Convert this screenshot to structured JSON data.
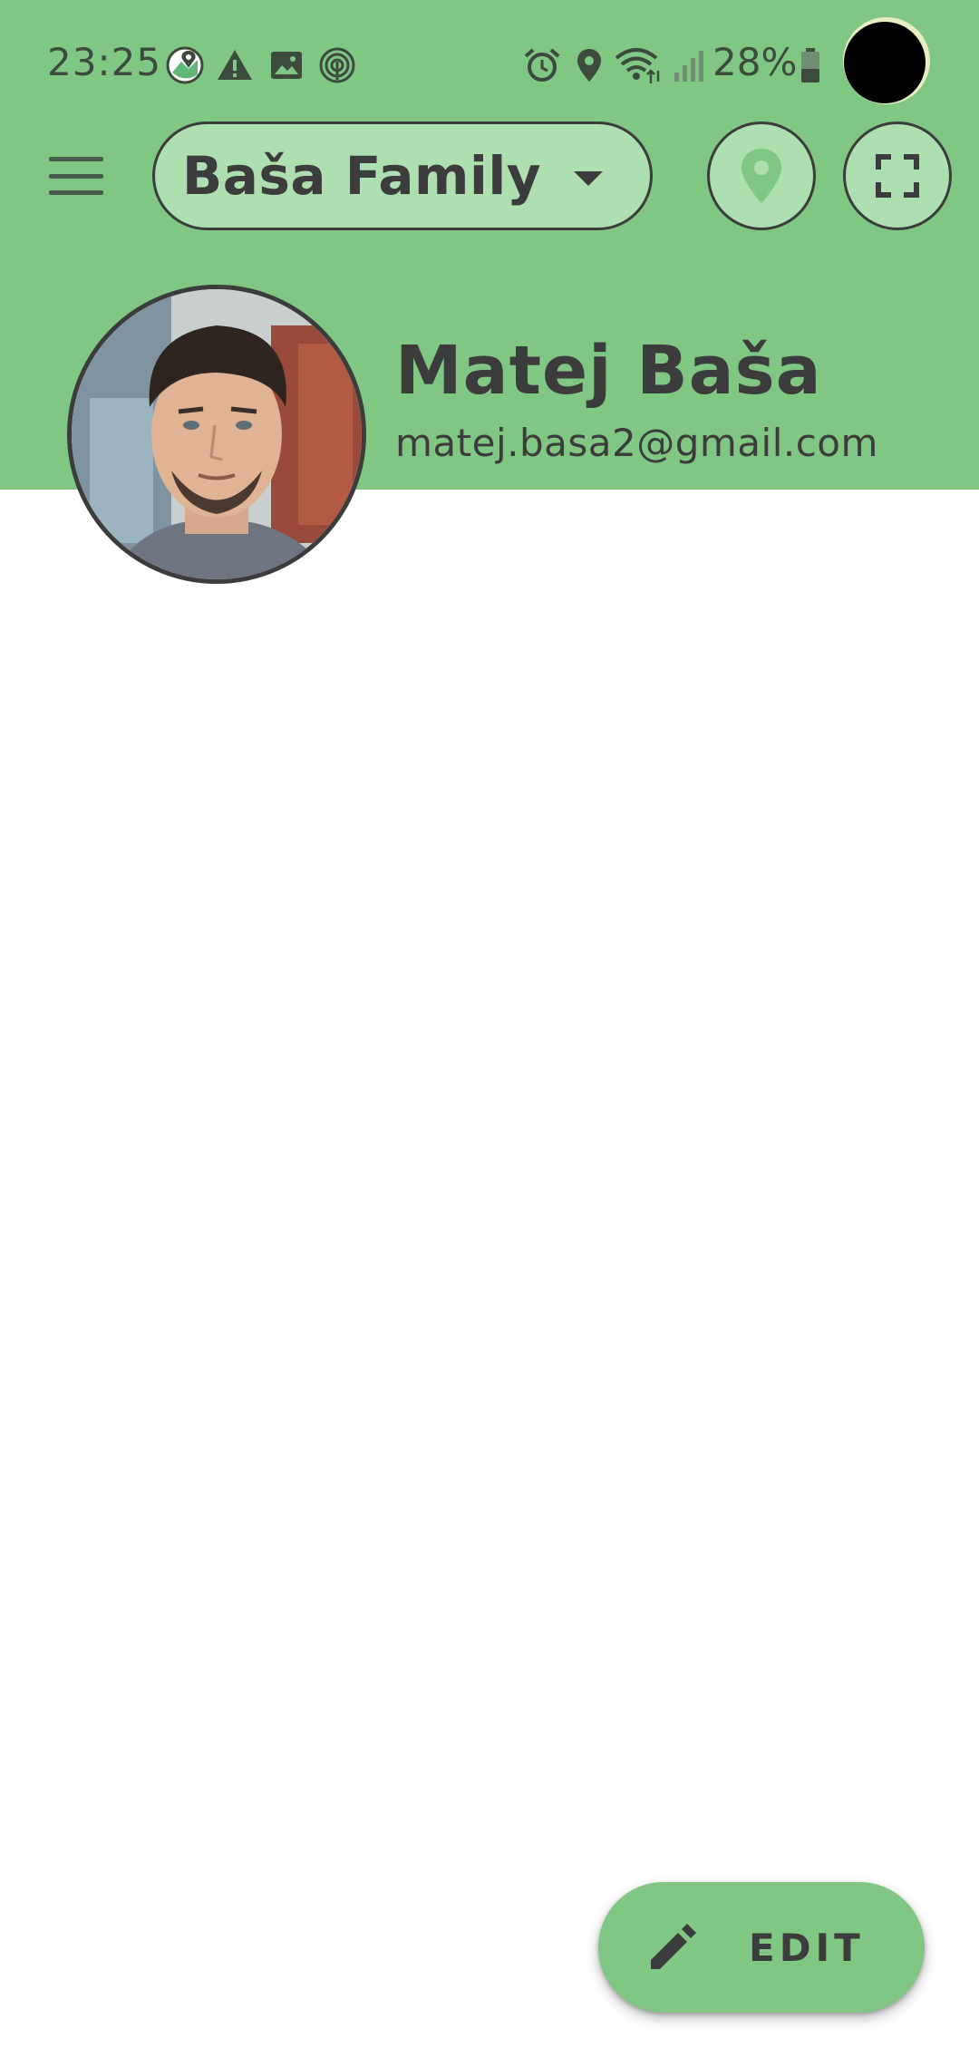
{
  "status_bar": {
    "time": "23:25",
    "battery_percent": "28%",
    "left_icons": [
      "maps-notification-icon",
      "warning-icon",
      "image-icon",
      "fingerprint-icon"
    ],
    "right_icons": [
      "alarm-icon",
      "location-icon",
      "wifi-icon",
      "signal-icon",
      "battery-icon"
    ]
  },
  "app_bar": {
    "family_selector": "Baša Family",
    "menu_icon": "menu-icon",
    "location_icon": "location-pin-icon",
    "fullscreen_icon": "fullscreen-icon"
  },
  "profile": {
    "name": "Matej Baša",
    "email": "matej.basa2@gmail.com"
  },
  "fab": {
    "label": "EDIT",
    "icon": "pencil-icon"
  },
  "colors": {
    "header_green": "#80c784",
    "control_green": "#addfb0",
    "dark_text": "#3c3c3c",
    "background": "#ffffff"
  }
}
